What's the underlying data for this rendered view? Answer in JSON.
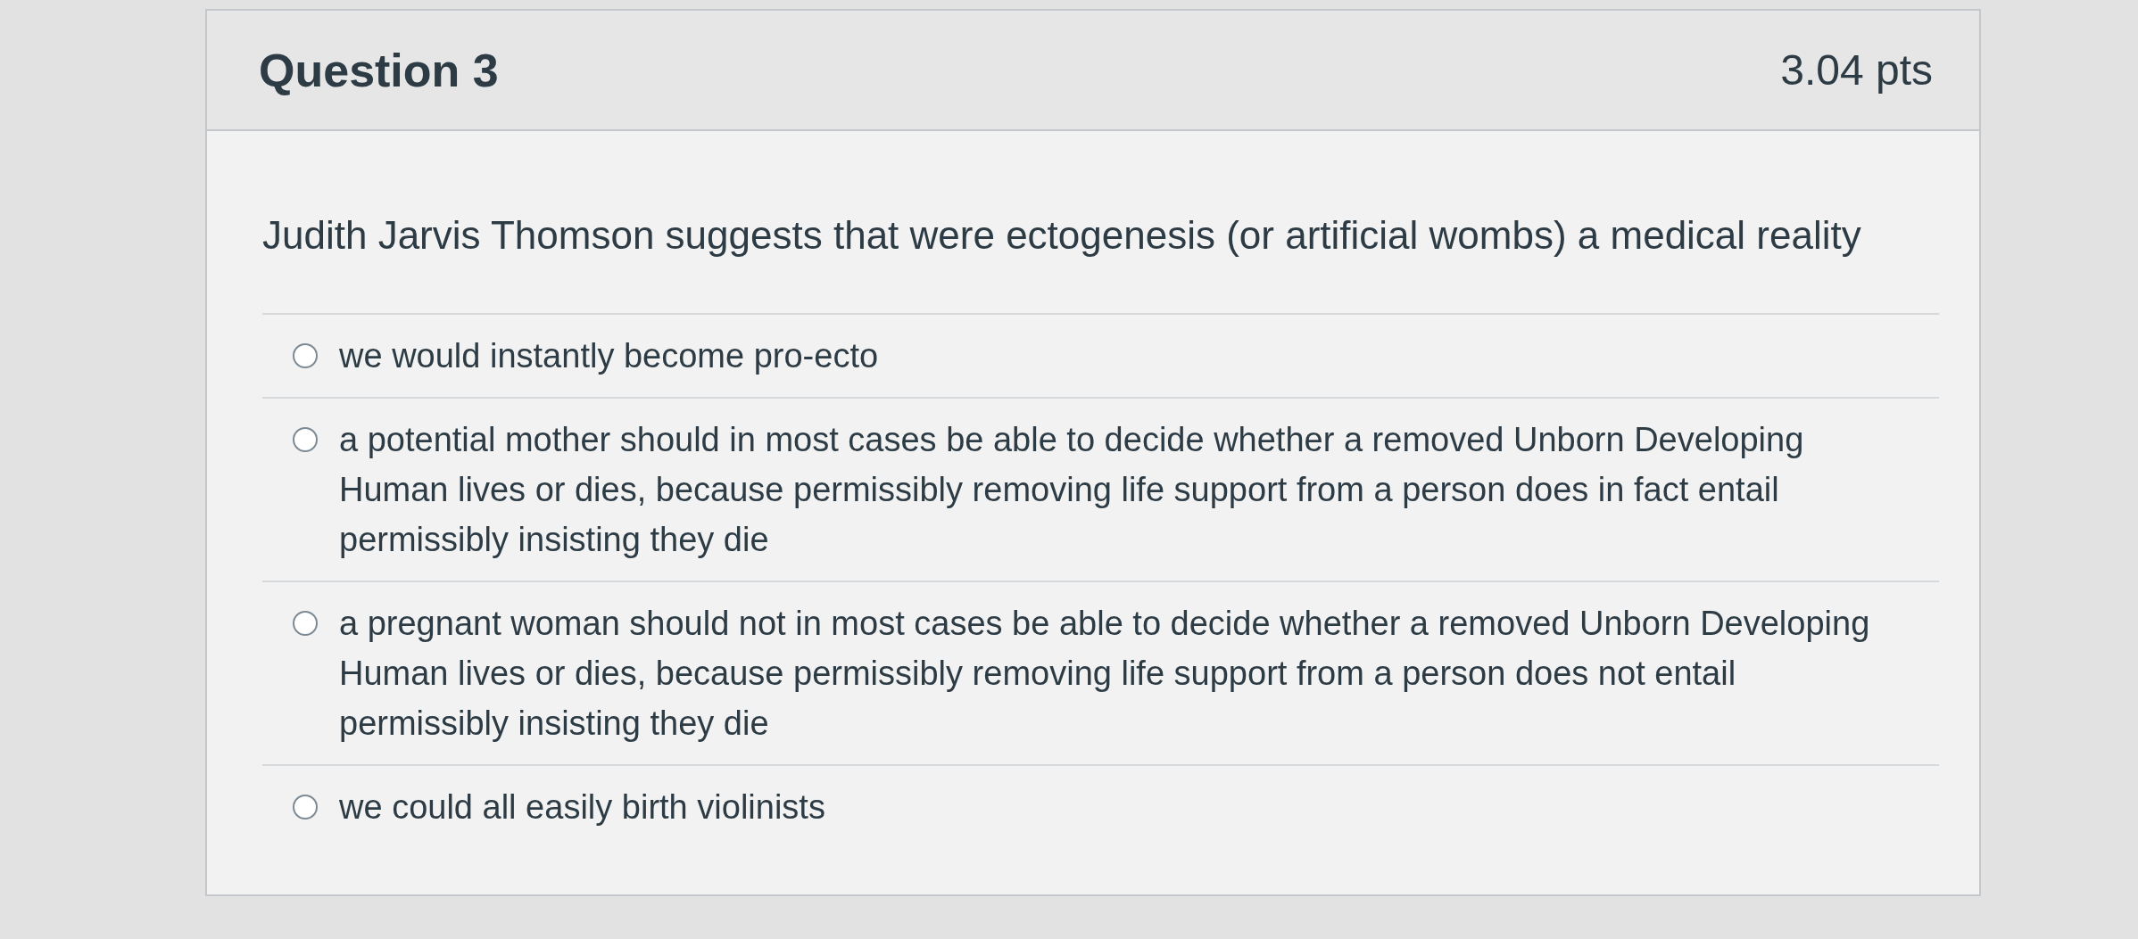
{
  "question": {
    "title": "Question 3",
    "points": "3.04 pts",
    "text": "Judith Jarvis Thomson suggests that were ectogenesis (or artificial wombs) a medical reality"
  },
  "answers": [
    {
      "text": "we would instantly become pro-ecto",
      "selected": false
    },
    {
      "text": "a potential mother should in most cases be able to decide whether a removed Unborn Developing Human lives or dies, because permissibly removing life support from a person does in fact entail permissibly insisting they die",
      "selected": false
    },
    {
      "text": "a pregnant woman should not in most cases be able to decide whether a removed Unborn Developing Human lives or dies, because permissibly removing life support from a person does not entail permissibly insisting they die",
      "selected": false
    },
    {
      "text": "we could all easily birth violinists",
      "selected": false
    }
  ]
}
